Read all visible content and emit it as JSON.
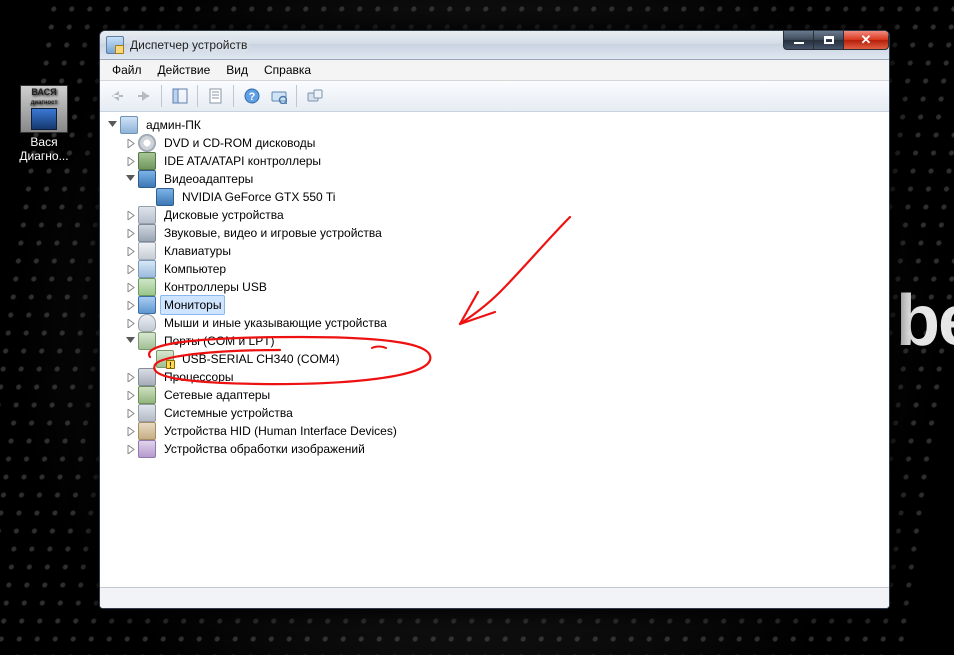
{
  "desktop": {
    "watermark": "bel",
    "icon": {
      "badge_top": "ВАСЯ",
      "badge_sub": "диагност",
      "line1": "Вася",
      "line2": "Диагно..."
    }
  },
  "window": {
    "title": "Диспетчер устройств",
    "menu": {
      "file": "Файл",
      "action": "Действие",
      "view": "Вид",
      "help": "Справка"
    },
    "tree": {
      "root": "админ-ПК",
      "dvd": "DVD и CD-ROM дисководы",
      "ide": "IDE ATA/ATAPI контроллеры",
      "video": "Видеоадаптеры",
      "video_child": "NVIDIA GeForce GTX 550 Ti",
      "disks": "Дисковые устройства",
      "sound": "Звуковые, видео и игровые устройства",
      "keyboards": "Клавиатуры",
      "computer": "Компьютер",
      "usb": "Контроллеры USB",
      "monitors": "Мониторы",
      "mice": "Мыши и иные указывающие устройства",
      "ports": "Порты (COM и LPT)",
      "ports_child": "USB-SERIAL CH340 (COM4)",
      "cpus": "Процессоры",
      "net": "Сетевые адаптеры",
      "sys": "Системные устройства",
      "hid": "Устройства HID (Human Interface Devices)",
      "imaging": "Устройства обработки изображений"
    }
  }
}
